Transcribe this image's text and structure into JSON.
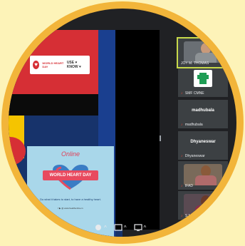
{
  "slide": {
    "logo_title": "WORLD HEART DAY",
    "use_know": "USE ♥ KNOW ♥",
    "brand": "Online",
    "banner": "WORLD HEART DAY",
    "tagline": "Do what it takes to start, to have a healthy heart.",
    "footer": "f ▶ @ www.healthonline.in"
  },
  "participants": [
    {
      "name": "JOY M. THOMAS",
      "type": "video",
      "highlight": true
    },
    {
      "name": "SMF CMNE",
      "type": "logo",
      "highlight": false
    },
    {
      "name": "madhubala",
      "display": "madhubala",
      "type": "name",
      "highlight": false
    },
    {
      "name": "Dhyaneswar",
      "display": "Dhyaneswar",
      "type": "name",
      "highlight": false
    },
    {
      "name": "IFAD",
      "type": "video",
      "highlight": false
    },
    {
      "name": "S.MOHAN",
      "type": "video",
      "highlight": false
    }
  ],
  "toolbar": {
    "icons": [
      "camera-icon",
      "share-screen-icon",
      "more-icon"
    ]
  },
  "colors": {
    "accent_ring": "#f2b53a",
    "background": "#fdf3b8",
    "active_speaker": "#c7d94a"
  }
}
